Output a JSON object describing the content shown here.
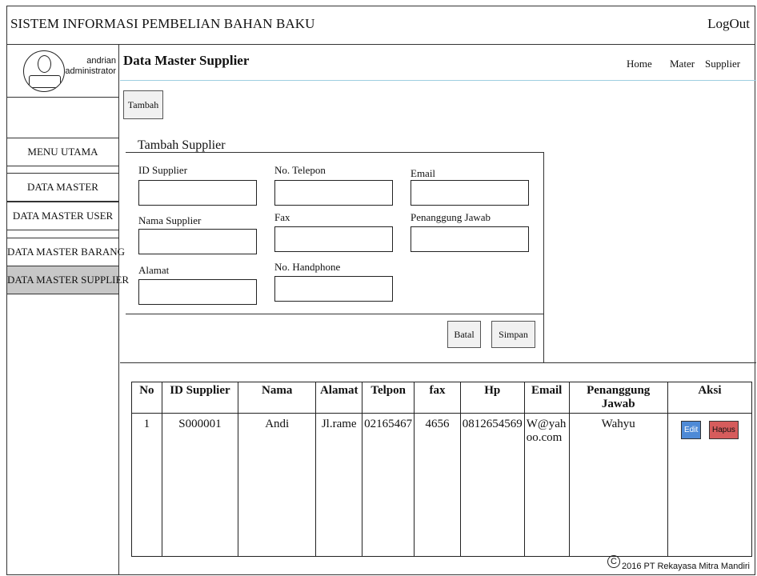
{
  "app": {
    "title": "SISTEM INFORMASI PEMBELIAN BAHAN BAKU",
    "logout_label": "LogOut"
  },
  "user": {
    "name": "andrian",
    "role": "administrator"
  },
  "sidebar": {
    "items": [
      {
        "label": "MENU UTAMA"
      },
      {
        "label": "DATA MASTER"
      },
      {
        "label": "DATA MASTER USER"
      },
      {
        "label": "DATA MASTER BARANG"
      },
      {
        "label": "DATA MASTER SUPPLIER",
        "active": true
      }
    ]
  },
  "header": {
    "title": "Data Master Supplier",
    "breadcrumb": [
      "Home",
      "Mater",
      "Supplier"
    ]
  },
  "toolbar": {
    "add_label": "Tambah"
  },
  "form": {
    "title": "Tambah Supplier",
    "fields": {
      "id_supplier": {
        "label": "ID Supplier",
        "value": ""
      },
      "no_telepon": {
        "label": "No. Telepon",
        "value": ""
      },
      "email": {
        "label": "Email",
        "value": ""
      },
      "nama_supplier": {
        "label": "Nama Supplier",
        "value": ""
      },
      "fax": {
        "label": "Fax",
        "value": ""
      },
      "penanggung_jawab": {
        "label": "Penanggung Jawab",
        "value": ""
      },
      "alamat": {
        "label": "Alamat",
        "value": ""
      },
      "no_handphone": {
        "label": "No. Handphone",
        "value": ""
      }
    },
    "cancel_label": "Batal",
    "save_label": "Simpan"
  },
  "table": {
    "columns": [
      "No",
      "ID Supplier",
      "Nama",
      "Alamat",
      "Telpon",
      "fax",
      "Hp",
      "Email",
      "Penanggung Jawab",
      "Aksi"
    ],
    "rows": [
      {
        "no": "1",
        "id": "S000001",
        "nama": "Andi",
        "alamat": "Jl.rame",
        "telpon": "02165467",
        "fax": "4656",
        "hp": "0812654569",
        "email": "W@yahoo.com",
        "penanggung_jawab": "Wahyu",
        "edit_label": "Edit",
        "delete_label": "Hapus"
      }
    ]
  },
  "footer": {
    "copyright_symbol": "C",
    "text": "2016 PT Rekayasa Mitra Mandiri"
  },
  "colors": {
    "active_menu": "#c7c7c7",
    "header_line": "#9ecfe0",
    "edit_button": "#4e8ad6",
    "delete_button": "#d65c5c"
  }
}
